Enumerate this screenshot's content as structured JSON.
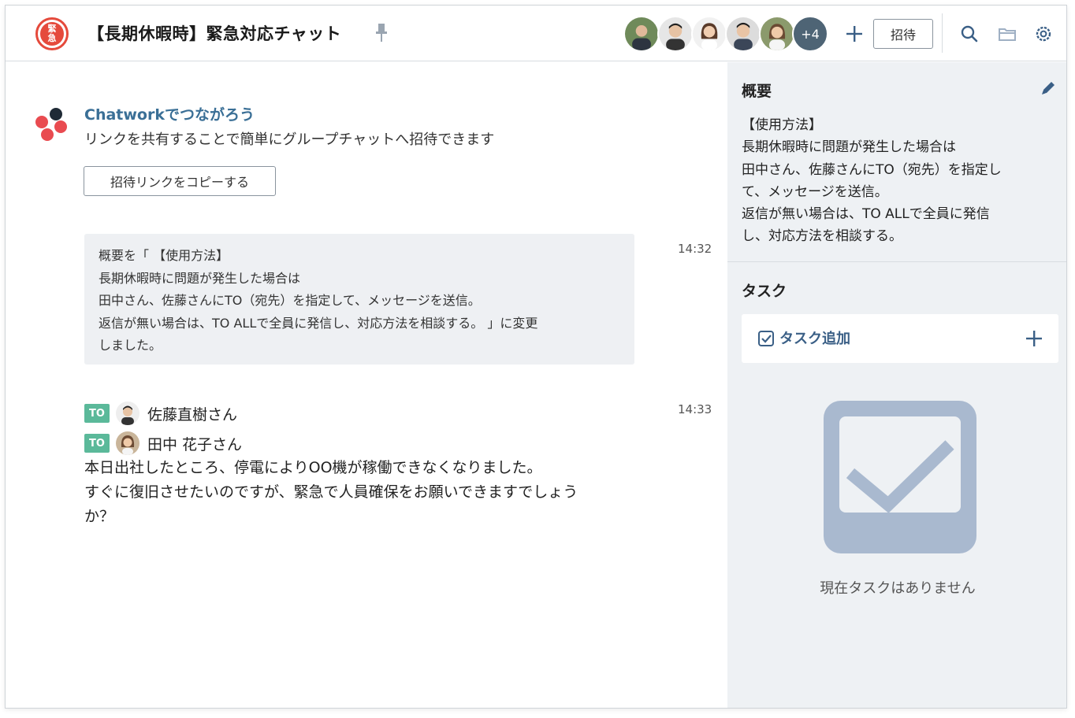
{
  "header": {
    "room_icon_text_line1": "緊",
    "room_icon_text_line2": "急",
    "room_title": "【長期休暇時】緊急対応チャット",
    "more_members": "+4",
    "invite_label": "招待"
  },
  "chat": {
    "promo": {
      "title": "Chatworkでつながろう",
      "text": "リンクを共有することで簡単にグループチャットへ招待できます",
      "copy_button": "招待リンクをコピーする"
    },
    "system_message": {
      "lines": [
        "概要を「 【使用方法】",
        "長期休暇時に問題が発生した場合は",
        "田中さん、佐藤さんにTO（宛先）を指定して、メッセージを送信。",
        "返信が無い場合は、TO ALLで全員に発信し、対応方法を相談する。 」に変更",
        "しました。"
      ],
      "time": "14:32"
    },
    "message": {
      "time": "14:33",
      "to": [
        {
          "badge": "TO",
          "name": "佐藤直樹さん"
        },
        {
          "badge": "TO",
          "name": "田中 花子さん"
        }
      ],
      "lines": [
        "本日出社したところ、停電によりOO機が稼働できなくなりました。",
        "すぐに復旧させたいのですが、緊急で人員確保をお願いできますでしょう",
        "か？"
      ]
    }
  },
  "panel": {
    "overview_title": "概要",
    "overview_lines": [
      "【使用方法】",
      "長期休暇時に問題が発生した場合は",
      "田中さん、佐藤さんにTO（宛先）を指定し",
      "て、メッセージを送信。",
      "返信が無い場合は、TO ALLで全員に発信",
      "し、対応方法を相談する。"
    ],
    "task_title": "タスク",
    "task_add_label": "タスク追加",
    "empty_text": "現在タスクはありません"
  },
  "colors": {
    "accent_red": "#e54a3c",
    "link_blue": "#3a6f96",
    "to_badge": "#5bb99a",
    "panel_bg": "#eef1f4",
    "empty_illustration": "#a9b9cf"
  },
  "icons": [
    "pin-icon",
    "plus-icon",
    "search-icon",
    "folder-icon",
    "gear-icon",
    "pencil-icon",
    "checkbox-icon",
    "chatwork-logo"
  ]
}
